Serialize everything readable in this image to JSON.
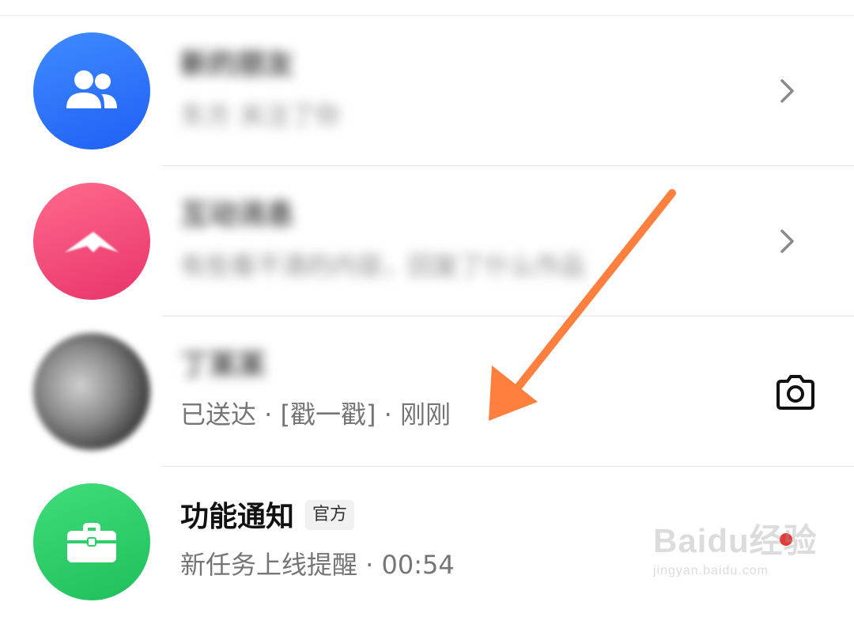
{
  "colors": {
    "friends_avatar": "#2f7bff",
    "interaction_avatar": "#f0507a",
    "notify_avatar": "#2ccf6b",
    "arrow": "#ff7f3f"
  },
  "rows": [
    {
      "title": "新的朋友",
      "subtitle": "东方 关注了你",
      "icon": "people-icon",
      "action": "chevron-right-icon"
    },
    {
      "title": "互动消息",
      "subtitle": "有些看不清的内容，回复了什么作品",
      "icon": "paper-plane-icon",
      "action": "chevron-right-icon"
    },
    {
      "title": "丁某某",
      "subtitle": "已送达 · [戳一戳] · 刚刚",
      "icon": "user-photo",
      "action": "camera-icon"
    },
    {
      "title": "功能通知",
      "badge": "官方",
      "subtitle": "新任务上线提醒 · 00:54",
      "icon": "briefcase-icon",
      "action": ""
    }
  ],
  "watermark": {
    "brand": "Baidu经验",
    "url": "jingyan.baidu.com"
  }
}
